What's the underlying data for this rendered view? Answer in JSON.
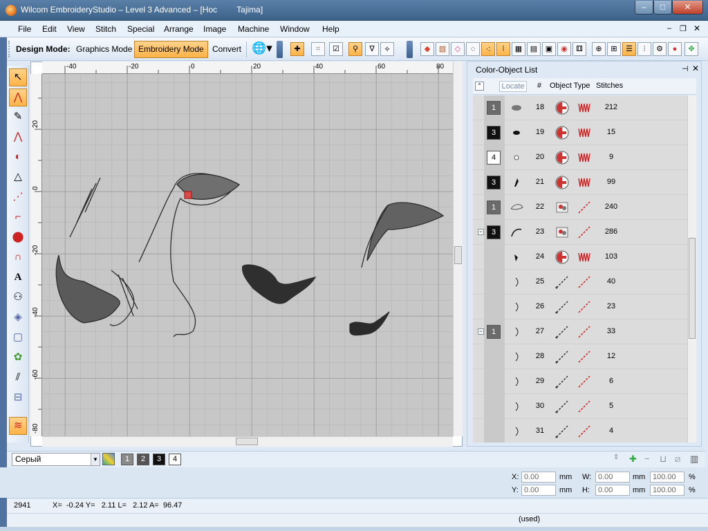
{
  "window": {
    "title_left": "Wilcom EmbroideryStudio – Level 3 Advanced – [Hoc",
    "title_right": "Tajima]",
    "min_glyph": "–",
    "max_glyph": "□",
    "close_glyph": "✕"
  },
  "menu": [
    "File",
    "Edit",
    "View",
    "Stitch",
    "Special",
    "Arrange",
    "Image",
    "Machine",
    "Window",
    "Help"
  ],
  "mdi_controls": {
    "min": "–",
    "restore": "❐",
    "close": "✕"
  },
  "toolbar": {
    "design_mode_label": "Design Mode:",
    "graphics_mode": "Graphics Mode",
    "embroidery_mode": "Embroidery Mode",
    "convert": "Convert"
  },
  "rulers": {
    "top_labels": [
      "-40",
      "-20",
      "0",
      "20",
      "40",
      "60",
      "80"
    ],
    "left_labels": [
      "20",
      "0",
      "-20",
      "-40",
      "-60",
      "-80"
    ]
  },
  "panel": {
    "title": "Color-Object List",
    "pin_glyph": "⊣",
    "close_glyph": "✕",
    "locate": "Locate",
    "columns": [
      "#",
      "Object Type",
      "Stitches"
    ],
    "rows": [
      {
        "color": "1",
        "shade": "mid",
        "num": "18",
        "otype": "complex-fill",
        "stype": "fill",
        "stitches": "212"
      },
      {
        "color": "3",
        "shade": "dark",
        "num": "19",
        "otype": "complex-fill",
        "stype": "fill",
        "stitches": "15"
      },
      {
        "color": "4",
        "shade": "light",
        "num": "20",
        "otype": "complex-fill",
        "stype": "fill",
        "stitches": "9"
      },
      {
        "color": "3",
        "shade": "dark",
        "num": "21",
        "otype": "complex-fill",
        "stype": "fill",
        "stitches": "99"
      },
      {
        "color": "1",
        "shade": "mid",
        "num": "22",
        "otype": "auto-digitize",
        "stype": "run",
        "stitches": "240"
      },
      {
        "color": "3",
        "shade": "dark",
        "num": "23",
        "otype": "auto-digitize",
        "stype": "run",
        "stitches": "286",
        "expander": "−"
      },
      {
        "color": "",
        "shade": "",
        "num": "24",
        "otype": "complex-fill",
        "stype": "fill",
        "stitches": "103"
      },
      {
        "color": "",
        "shade": "",
        "num": "25",
        "otype": "run-line",
        "stype": "run",
        "stitches": "40"
      },
      {
        "color": "",
        "shade": "",
        "num": "26",
        "otype": "run-line",
        "stype": "run",
        "stitches": "23"
      },
      {
        "color": "1",
        "shade": "mid",
        "num": "27",
        "otype": "run-line",
        "stype": "run",
        "stitches": "33",
        "expander": "−"
      },
      {
        "color": "",
        "shade": "",
        "num": "28",
        "otype": "run-line",
        "stype": "run",
        "stitches": "12"
      },
      {
        "color": "",
        "shade": "",
        "num": "29",
        "otype": "run-line",
        "stype": "run",
        "stitches": "6"
      },
      {
        "color": "",
        "shade": "",
        "num": "30",
        "otype": "run-line",
        "stype": "run",
        "stitches": "5"
      },
      {
        "color": "",
        "shade": "",
        "num": "31",
        "otype": "run-line",
        "stype": "run",
        "stitches": "4"
      }
    ]
  },
  "palette": {
    "selected_color": "Серый",
    "chips": [
      "1",
      "2",
      "3",
      "4"
    ]
  },
  "transform": {
    "x_label": "X:",
    "x_value": "0.00",
    "x_unit": "mm",
    "y_label": "Y:",
    "y_value": "0.00",
    "y_unit": "mm",
    "w_label": "W:",
    "w_value": "0.00",
    "w_unit": "mm",
    "h_label": "H:",
    "h_value": "0.00",
    "h_unit": "mm",
    "w_pct": "100.00",
    "h_pct": "100.00",
    "pct_unit": "%"
  },
  "status": {
    "count": "2941",
    "coords": "X=  -0.24 Y=   2.11 L=   2.12 A=  96.47",
    "used": "(used)"
  }
}
